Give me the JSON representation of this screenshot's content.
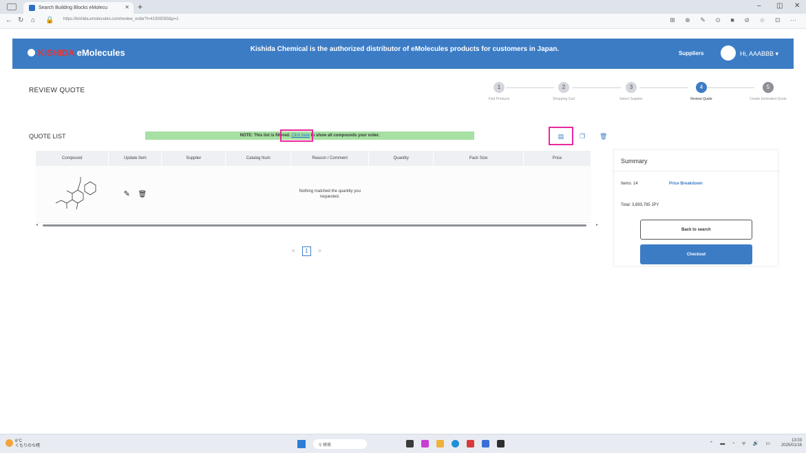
{
  "browser": {
    "tab_title": "Search Building Blocks eMolecu",
    "url": "https://kishida.emolecules.com/review_order?t=41903083&p=1"
  },
  "header": {
    "logo_brand": "KISHIDA",
    "logo_text": "eMolecules",
    "banner": "Kishida Chemical is the authorized distributor of eMolecules products for customers in Japan.",
    "suppliers": "Suppliers",
    "greeting": "Hi, AAABBB"
  },
  "page": {
    "title": "REVIEW QUOTE"
  },
  "stepper": {
    "steps": [
      {
        "num": "1",
        "label": "Find Products"
      },
      {
        "num": "2",
        "label": "Shopping Cart"
      },
      {
        "num": "3",
        "label": "Select Supplier"
      },
      {
        "num": "4",
        "label": "Review Quote"
      },
      {
        "num": "5",
        "label": "Create Estimated Quote"
      }
    ]
  },
  "quote_list": {
    "label": "QUOTE LIST",
    "note_before": "NOTE: This list is filtered.",
    "note_link": "Click here",
    "note_after": "to show all compounds your order."
  },
  "table": {
    "columns": [
      "Compound",
      "Update Item",
      "Supplier",
      "Catalog Num",
      "Reason / Comment",
      "Quantity",
      "Pack Size",
      "Price"
    ],
    "row": {
      "reason": "Nothing matched the quantity you requested."
    }
  },
  "pagination": {
    "current": "1",
    "prev": "<",
    "next": ">"
  },
  "summary": {
    "title": "Summary",
    "items": "Items: 14",
    "price_breakdown": "Price Breakdown",
    "total": "Total: 3,893,795 JPY",
    "back_button": "Back to search",
    "checkout_button": "Checkout"
  },
  "taskbar": {
    "weather_temp": "6°C",
    "weather_desc": "くもりのち晴",
    "search_placeholder": "検索",
    "time": "13:03",
    "date": "2025/01/16"
  },
  "colors": {
    "brand_blue": "#3c7cc5",
    "note_green": "#a6e0a2",
    "highlight_pink": "#e8289a"
  }
}
